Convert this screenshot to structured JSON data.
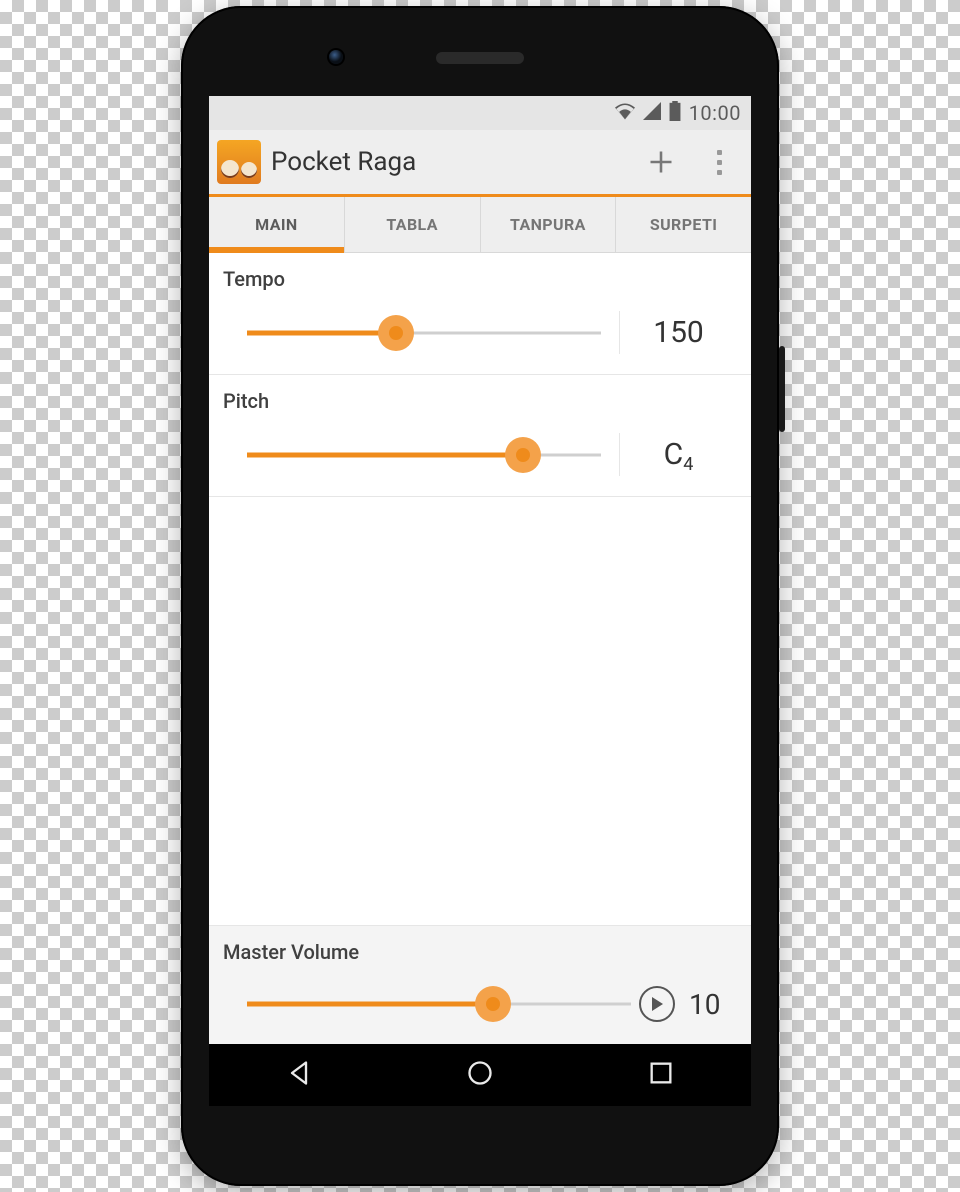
{
  "status": {
    "time": "10:00"
  },
  "app": {
    "title": "Pocket Raga",
    "icon_alt": "app-logo",
    "actions": {
      "add": "+"
    }
  },
  "tabs": [
    {
      "label": "MAIN",
      "active": true
    },
    {
      "label": "TABLA",
      "active": false
    },
    {
      "label": "TANPURA",
      "active": false
    },
    {
      "label": "SURPETI",
      "active": false
    }
  ],
  "settings": {
    "tempo": {
      "label": "Tempo",
      "value": "150",
      "percent": 42
    },
    "pitch": {
      "label": "Pitch",
      "value_note": "C",
      "value_octave": "4",
      "percent": 78
    }
  },
  "footer": {
    "label": "Master Volume",
    "value": "10",
    "percent": 64
  },
  "colors": {
    "accent": "#ef8b1b"
  }
}
